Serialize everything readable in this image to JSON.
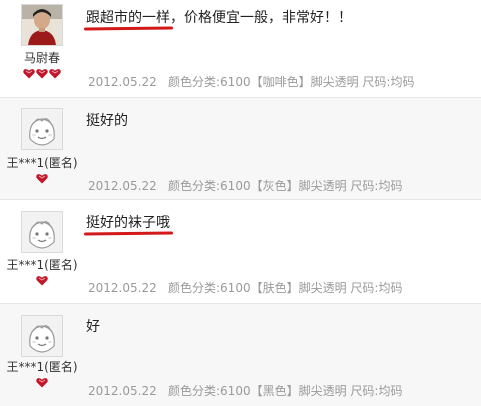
{
  "reviews": [
    {
      "user": "马尉春",
      "content_highlight": "跟超市的一样",
      "content_rest": "，价格便宜一般，非常好！！",
      "date": "2012.05.22",
      "attrs": "颜色分类:6100【咖啡色】脚尖透明  尺码:均码"
    },
    {
      "user": "王***1(匿名)",
      "content_highlight": "",
      "content_rest": "挺好的",
      "date": "2012.05.22",
      "attrs": "颜色分类:6100【灰色】脚尖透明  尺码:均码"
    },
    {
      "user": "王***1(匿名)",
      "content_highlight": "挺好的袜子哦",
      "content_rest": "",
      "date": "2012.05.22",
      "attrs": "颜色分类:6100【肤色】脚尖透明  尺码:均码"
    },
    {
      "user": "王***1(匿名)",
      "content_highlight": "",
      "content_rest": "好",
      "date": "2012.05.22",
      "attrs": "颜色分类:6100【黑色】脚尖透明  尺码:均码"
    }
  ],
  "colors": {
    "highlight_underline": "#d31919",
    "heart": "#c0182a",
    "meta_text": "#9a9a9a"
  },
  "icons": [
    "default-avatar-icon",
    "user-photo",
    "heart-badge-icon"
  ]
}
